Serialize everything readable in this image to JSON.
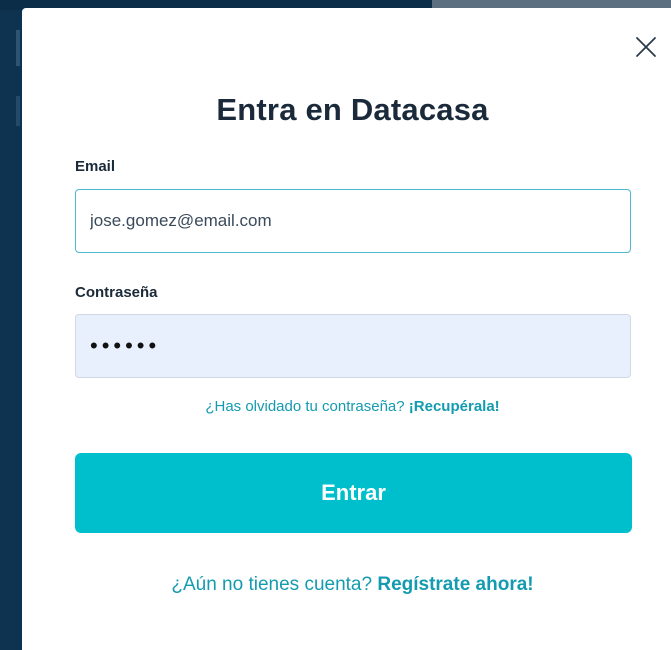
{
  "modal": {
    "title": "Entra en Datacasa",
    "close_icon": "close-icon"
  },
  "email": {
    "label": "Email",
    "value": "jose.gomez@email.com"
  },
  "password": {
    "label": "Contraseña",
    "value": "••••••"
  },
  "recover": {
    "prompt": "¿Has olvidado tu contraseña?",
    "link": "¡Recupérala!"
  },
  "submit": {
    "label": "Entrar"
  },
  "register": {
    "prompt": "¿Aún no tienes cuenta?",
    "link": "Regístrate ahora!"
  },
  "colors": {
    "accent": "#00bfcc",
    "link": "#149bb0",
    "title": "#1b2a3a",
    "password_bg": "#e8effd",
    "backdrop": "#0d3350"
  }
}
